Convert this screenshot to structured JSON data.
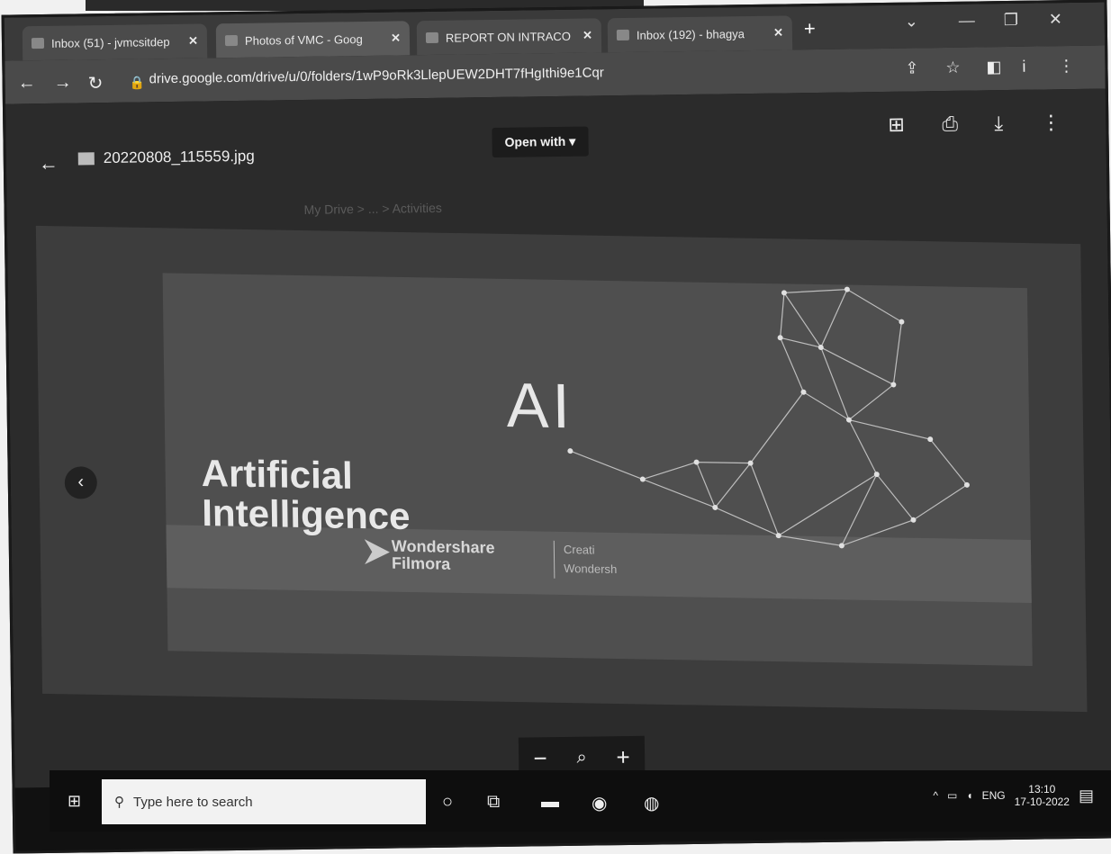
{
  "browser": {
    "tabs": [
      {
        "label": "Inbox (51) - jvmcsitdep"
      },
      {
        "label": "Photos of VMC - Goog"
      },
      {
        "label": "REPORT ON INTRACO"
      },
      {
        "label": "Inbox (192) - bhagya"
      }
    ],
    "url": "drive.google.com/drive/u/0/folders/1wP9oRk3LlepUEW2DHT7fHgIthi9e1Cqr"
  },
  "viewer": {
    "filename": "20220808_115559.jpg",
    "open_with_label": "Open with",
    "ghost_breadcrumb": "My Drive  >  ...  >  Activities"
  },
  "image": {
    "ai": "AI",
    "title_line1": "Artificial",
    "title_line2": "Intelligence",
    "brand_line1": "Wondershare",
    "brand_line2": "Filmora",
    "side_line1": "Creati",
    "side_line2": "Wondersh"
  },
  "zoom": {
    "minus": "−",
    "zoom_icon": "🔍",
    "plus": "+"
  },
  "taskbar": {
    "search_placeholder": "Type here to search",
    "language": "ENG",
    "time": "13:10",
    "date": "17-10-2022"
  }
}
